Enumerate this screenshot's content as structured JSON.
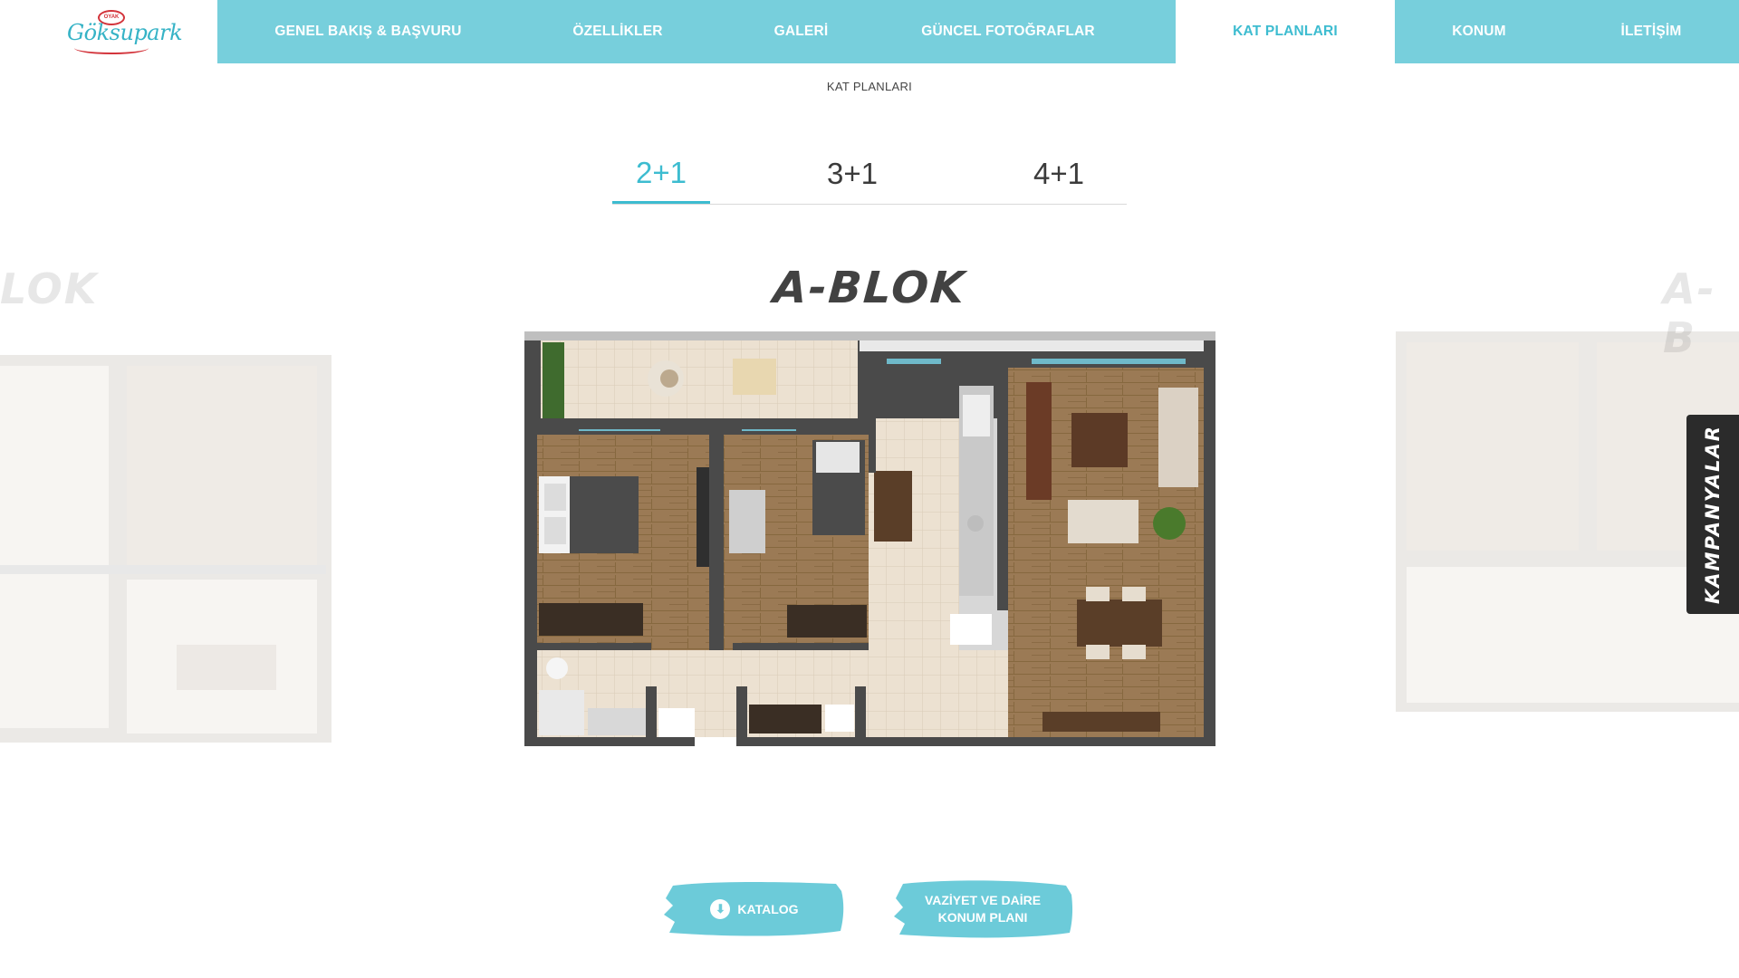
{
  "logo": {
    "badge": "OYAK",
    "script": "Göksupark"
  },
  "nav": {
    "items": [
      {
        "label": "GENEL BAKIŞ & BAŞVURU"
      },
      {
        "label": "ÖZELLİKLER"
      },
      {
        "label": "GALERİ"
      },
      {
        "label": "GÜNCEL FOTOĞRAFLAR"
      },
      {
        "label": "KAT PLANLARI"
      },
      {
        "label": "KONUM"
      },
      {
        "label": "İLETİŞİM"
      }
    ],
    "active": "KAT PLANLARI"
  },
  "breadcrumb": "KAT PLANLARI",
  "tabs": [
    {
      "label": "2+1"
    },
    {
      "label": "3+1"
    },
    {
      "label": "4+1"
    }
  ],
  "active_tab": "2+1",
  "carousel": {
    "title": "A-BLOK",
    "prev_title_fragment": "LOK",
    "next_title_fragment": "A-B"
  },
  "side_tab": "KAMPANYALAR",
  "buttons": {
    "catalog": "KATALOG",
    "site_plan_line1": "VAZİYET VE DAİRE",
    "site_plan_line2": "KONUM PLANI"
  },
  "colors": {
    "accent": "#77cfdc",
    "active_text": "#3dbcd0",
    "logo_red": "#d3343b",
    "dark_tab": "#2b2b2b"
  }
}
